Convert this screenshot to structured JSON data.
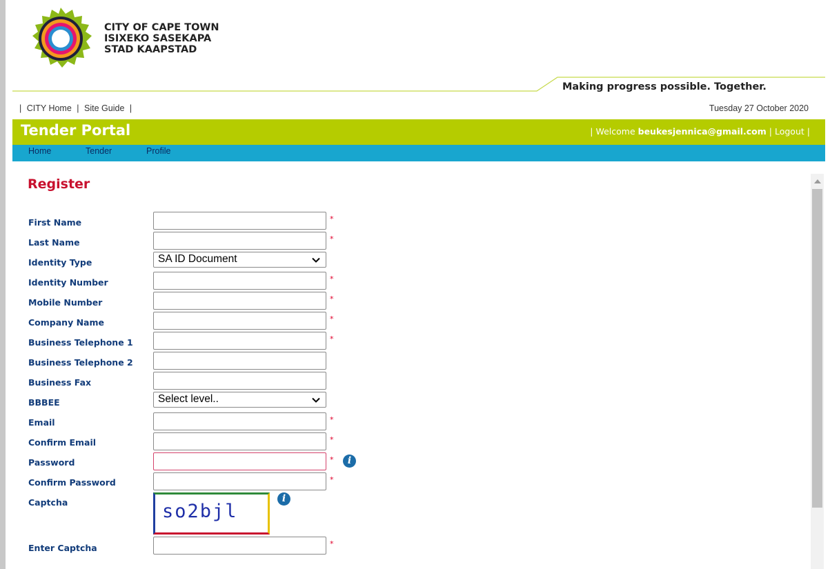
{
  "org": {
    "line1": "CITY OF CAPE TOWN",
    "line2": "ISIXEKO SASEKAPA",
    "line3": "STAD KAAPSTAD",
    "tagline": "Making progress possible. Together."
  },
  "util_nav": {
    "sep": "|",
    "home": "CITY Home",
    "site_guide": "Site Guide"
  },
  "date": "Tuesday 27 October 2020",
  "portal": {
    "title": "Tender Portal",
    "welcome_prefix": "| Welcome",
    "user": "beukesjennica@gmail.com",
    "sep": "|",
    "logout": "Logout"
  },
  "main_nav": [
    "Home",
    "Tender",
    "Profile"
  ],
  "form": {
    "title": "Register",
    "required_mark": "*",
    "fields": {
      "first_name": "First Name",
      "last_name": "Last Name",
      "identity_type": "Identity Type",
      "identity_number": "Identity Number",
      "mobile_number": "Mobile Number",
      "company_name": "Company Name",
      "business_tel_1": "Business Telephone 1",
      "business_tel_2": "Business Telephone 2",
      "business_fax": "Business Fax",
      "bbbee": "BBBEE",
      "email": "Email",
      "confirm_email": "Confirm Email",
      "password": "Password",
      "confirm_password": "Confirm Password",
      "captcha": "Captcha",
      "enter_captcha": "Enter Captcha"
    },
    "identity_type_value": "SA ID Document",
    "bbbee_value": "Select level..",
    "captcha_text": "so2bjl"
  },
  "colors": {
    "portal_green": "#b5cc00",
    "nav_blue": "#18a6cf",
    "label_blue": "#123c7a",
    "register_red": "#c8102e"
  }
}
